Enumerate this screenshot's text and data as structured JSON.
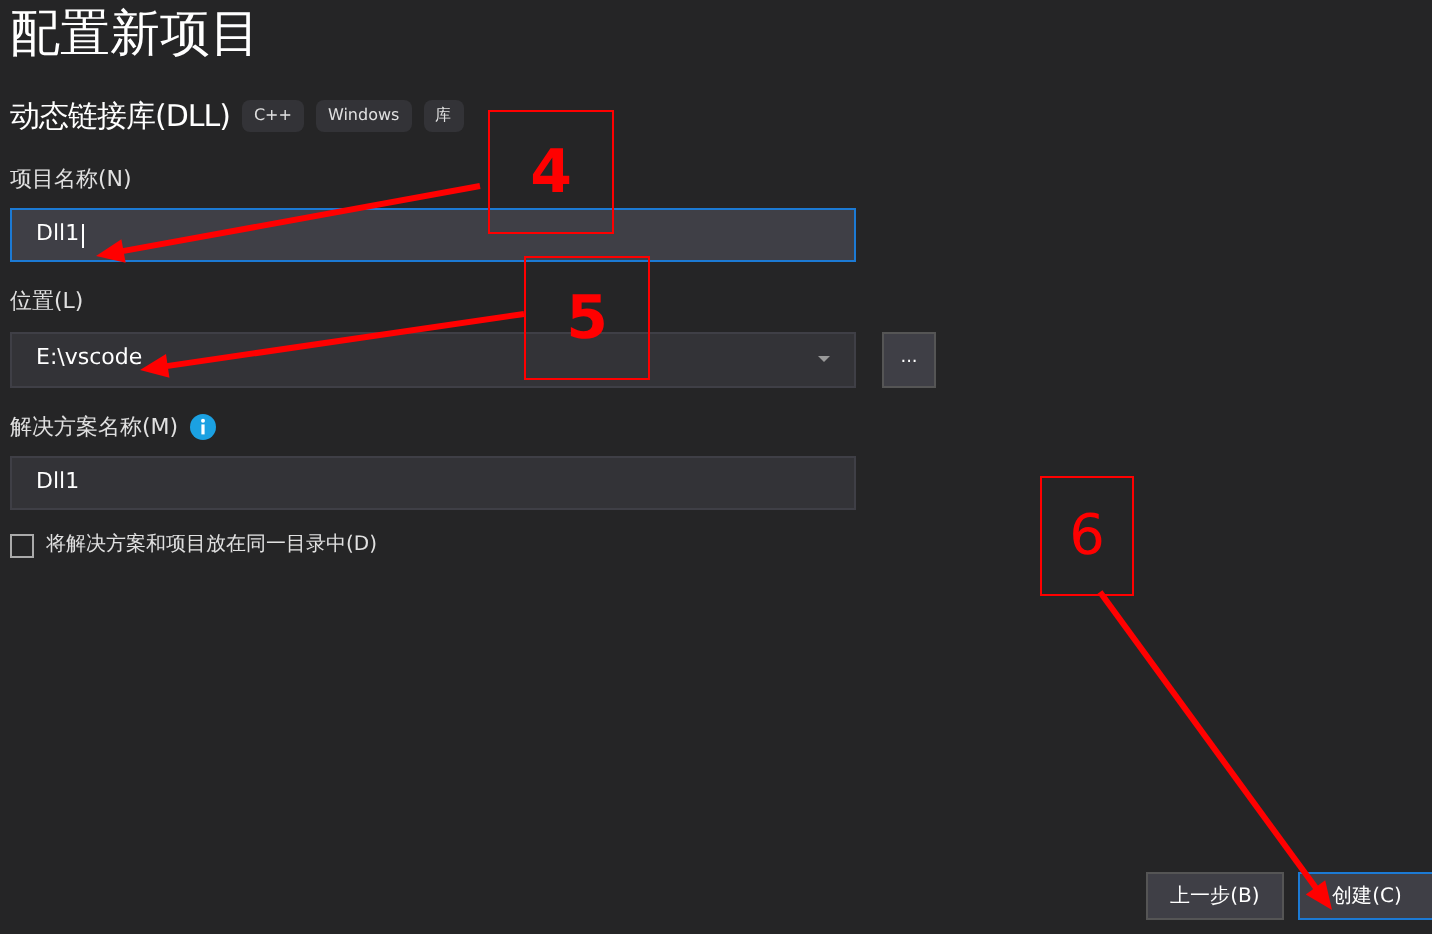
{
  "title": "配置新项目",
  "template": {
    "name": "动态链接库(DLL)",
    "tags": [
      "C++",
      "Windows",
      "库"
    ]
  },
  "project_name": {
    "label": "项目名称(N)",
    "value": "Dll1",
    "focused": true
  },
  "location": {
    "label": "位置(L)",
    "value": "E:\\vscode",
    "browse": "..."
  },
  "solution_name": {
    "label": "解决方案名称(M)",
    "value": "Dll1"
  },
  "same_directory": {
    "label": "将解决方案和项目放在同一目录中(D)",
    "checked": false
  },
  "buttons": [
    {
      "label": "上一步(B)",
      "primary": false
    },
    {
      "label": "创建(C)",
      "primary": true
    }
  ],
  "annotations": [
    {
      "number": "4"
    },
    {
      "number": "5"
    },
    {
      "number": "6"
    }
  ]
}
